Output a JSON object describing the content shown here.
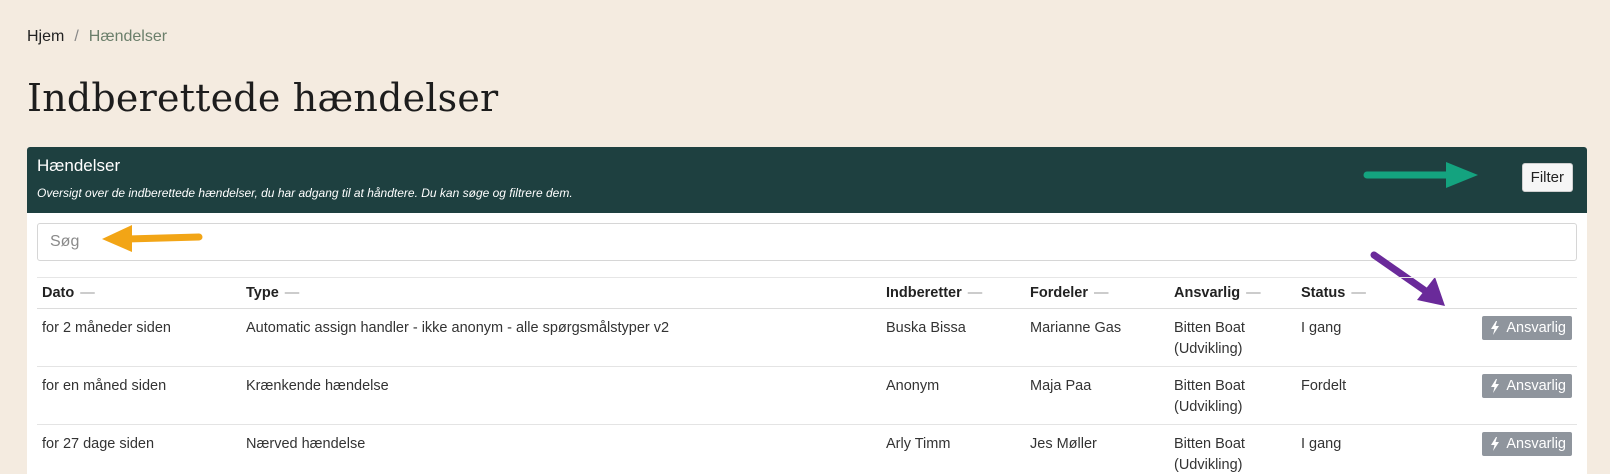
{
  "breadcrumb": {
    "home": "Hjem",
    "separator": "/",
    "current": "Hændelser"
  },
  "page_title": "Indberettede hændelser",
  "card": {
    "title": "Hændelser",
    "subtitle": "Oversigt over de indberettede hændelser, du har adgang til at håndtere. Du kan søge og filtrere dem.",
    "filter_label": "Filter"
  },
  "search": {
    "placeholder": "Søg",
    "value": ""
  },
  "table": {
    "columns": [
      "Dato",
      "Type",
      "Indberetter",
      "Fordeler",
      "Ansvarlig",
      "Status"
    ],
    "sort_indicator": "—",
    "action_label": "Ansvarlig",
    "rows": [
      {
        "dato": "for 2 måneder siden",
        "type": "Automatic assign handler - ikke anonym - alle spørgsmålstyper v2",
        "indberetter": "Buska Bissa",
        "fordeler": "Marianne Gas",
        "ansvarlig_1": "Bitten Boat",
        "ansvarlig_2": "(Udvikling)",
        "status": "I gang"
      },
      {
        "dato": "for en måned siden",
        "type": "Krænkende hændelse",
        "indberetter": "Anonym",
        "fordeler": "Maja Paa",
        "ansvarlig_1": "Bitten Boat",
        "ansvarlig_2": "(Udvikling)",
        "status": "Fordelt"
      },
      {
        "dato": "for 27 dage siden",
        "type": "Nærved hændelse",
        "indberetter": "Arly Timm",
        "fordeler": "Jes Møller",
        "ansvarlig_1": "Bitten Boat",
        "ansvarlig_2": "(Udvikling)",
        "status": "I gang"
      }
    ]
  },
  "icons": {
    "action": "bolt-icon"
  },
  "colors": {
    "background": "#f4ebe0",
    "header": "#1e4040",
    "action_button": "#8f959d",
    "arrow_green": "#14a37f",
    "arrow_orange": "#f2a516",
    "arrow_purple": "#6a2a9a"
  }
}
